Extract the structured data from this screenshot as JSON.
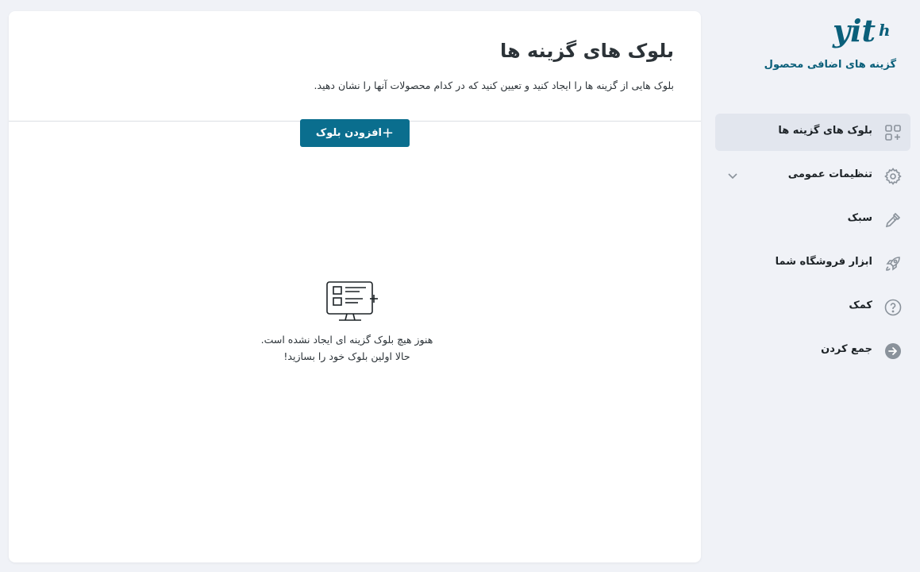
{
  "brand": {
    "logo_text": "yith",
    "name": "گزینه های اضافی محصول",
    "color": "#0a5f7a"
  },
  "sidebar": {
    "items": [
      {
        "label": "بلوک های گزینه ها",
        "icon": "blocks-add-icon",
        "active": true
      },
      {
        "label": "تنظیمات عمومی",
        "icon": "gear-icon",
        "has_submenu": true
      },
      {
        "label": "سبک",
        "icon": "eyedropper-icon"
      },
      {
        "label": "ابزار فروشگاه شما",
        "icon": "rocket-icon"
      },
      {
        "label": "کمک",
        "icon": "help-circle-icon"
      },
      {
        "label": "جمع کردن",
        "icon": "collapse-arrow-icon"
      }
    ]
  },
  "main": {
    "title": "بلوک های گزینه ها",
    "description": "بلوک هایی از گزینه ها را ایجاد کنید و تعیین کنید که در کدام محصولات آنها را نشان دهید.",
    "empty_state": {
      "icon": "monitor-blocks-icon",
      "line1": "هنوز هیچ بلوک گزینه ای ایجاد نشده است.",
      "line2": "حالا اولین بلوک خود را بسازید!",
      "button_label": "افزودن بلوک",
      "button_icon": "plus-icon"
    }
  },
  "colors": {
    "accent": "#0a6e8e",
    "background": "#f0f2f7",
    "active_item": "#e2e6ee"
  }
}
